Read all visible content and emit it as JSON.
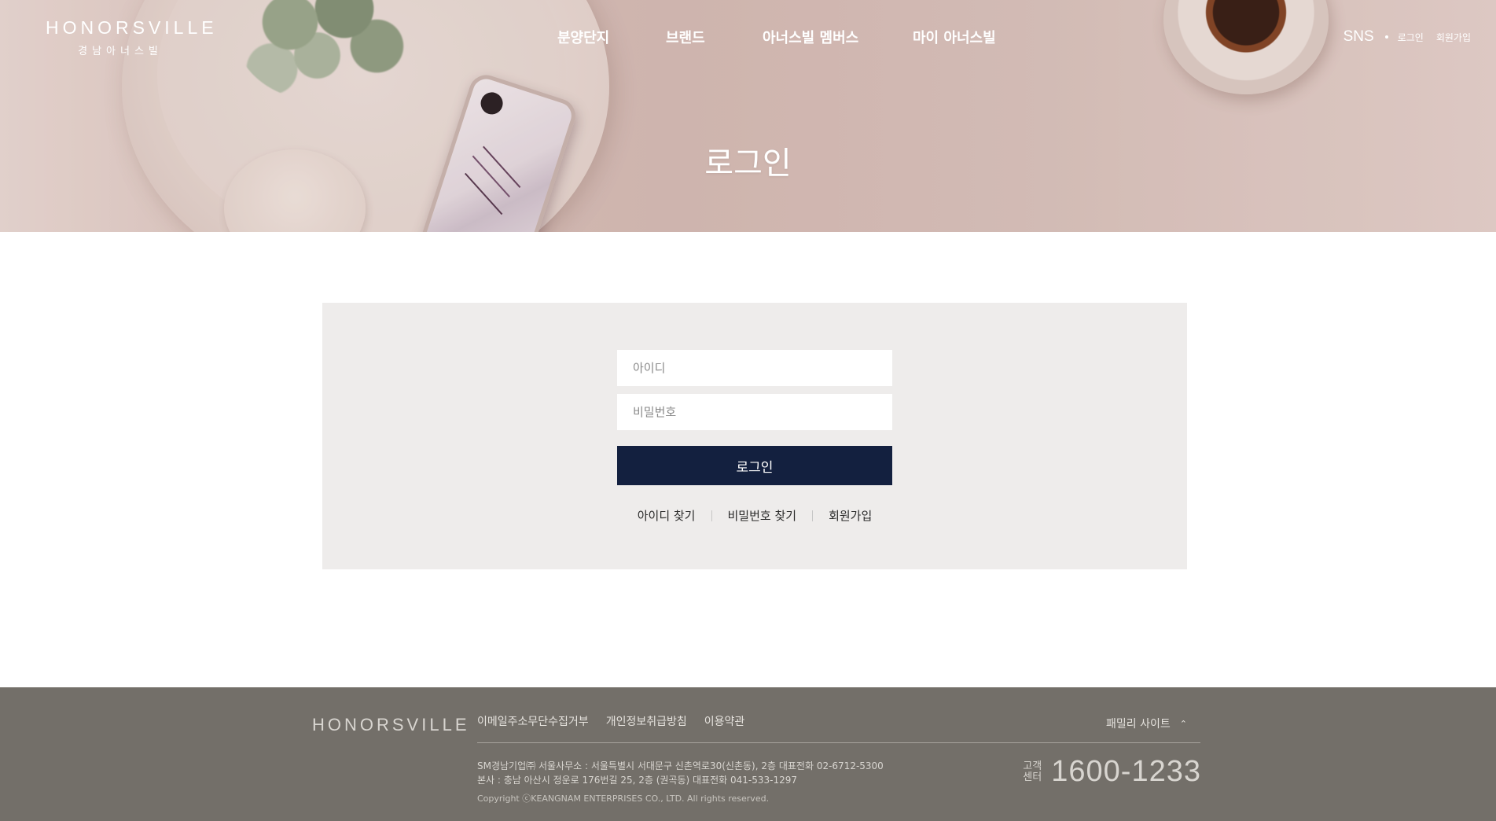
{
  "header": {
    "logo": {
      "main": "HONORSVILLE",
      "sub": "경남아너스빌"
    },
    "nav": [
      {
        "label": "분양단지"
      },
      {
        "label": "브랜드"
      },
      {
        "label": "아너스빌 멤버스"
      },
      {
        "label": "마이 아너스빌"
      }
    ],
    "util": {
      "sns": "SNS",
      "login": "로그인",
      "signup": "회원가입"
    }
  },
  "page": {
    "title": "로그인"
  },
  "login": {
    "id_placeholder": "아이디",
    "pw_placeholder": "비밀번호",
    "submit_label": "로그인",
    "links": [
      "아이디 찾기",
      "비밀번호 찾기",
      "회원가입"
    ]
  },
  "footer": {
    "logo": "HONORSVILLE",
    "links": [
      "이메일주소무단수집거부",
      "개인정보취급방침",
      "이용약관"
    ],
    "family_site": "패밀리 사이트",
    "family_icon": "chevron-up-icon",
    "address_line1": "SM경남기업㈜ 서울사무소 : 서울특별시 서대문구 신촌역로30(신촌동), 2층 대표전화 02-6712-5300",
    "address_line2": "본사 : 충남 아산시 정운로 176번길 25, 2층 (권곡동) 대표전화 041-533-1297",
    "copyright": "Copyright ⓒKEANGNAM ENTERPRISES CO., LTD. All rights reserved.",
    "cs_label": "고객 센터",
    "cs_number": "1600-1233"
  },
  "colors": {
    "primary_button": "#13203f",
    "login_panel": "#eeeceb",
    "footer_bg": "#736f69"
  }
}
